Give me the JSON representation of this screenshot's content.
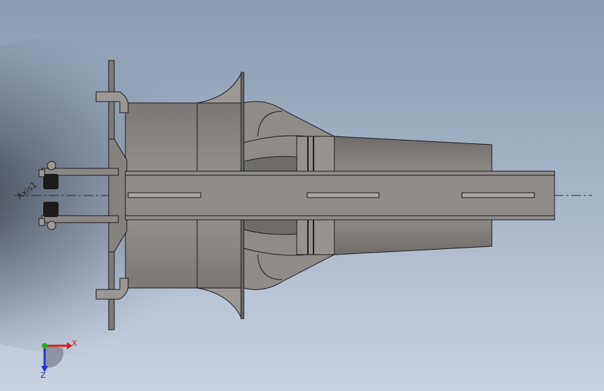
{
  "graphics_area": {
    "axis_label": "Axis1",
    "triad": {
      "x_label": "X",
      "z_label": "Z",
      "colors": {
        "x": "#d21f1f",
        "y": "#22b022",
        "z": "#2233cc"
      }
    }
  },
  "model": {
    "fill_colors": {
      "body": "#8a8785",
      "light": "#a7a4a1",
      "dark": "#5c5a58",
      "edge": "#1a1a1a"
    }
  }
}
